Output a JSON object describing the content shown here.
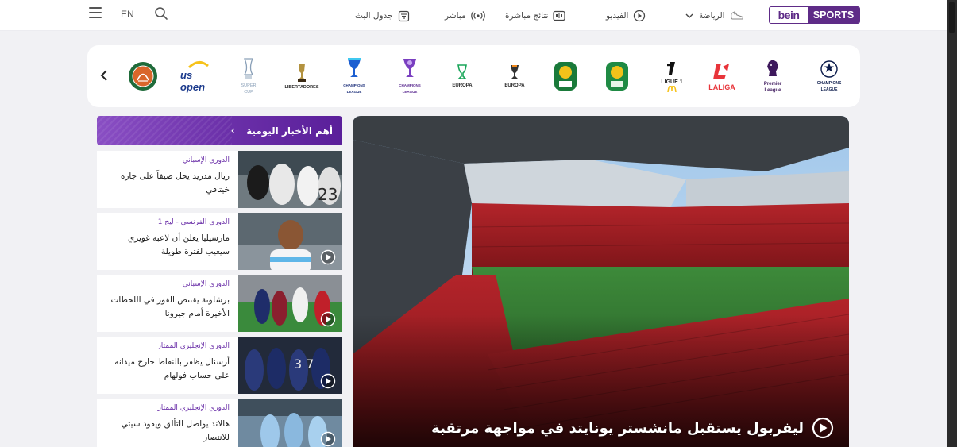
{
  "header": {
    "lang": "EN",
    "nav": [
      {
        "label": "جدول البث",
        "icon": "schedule-icon"
      },
      {
        "label": "مباشر",
        "icon": "live-broadcast-icon"
      },
      {
        "label": "نتائج مباشرة",
        "icon": "scoreboard-icon"
      },
      {
        "label": "الفيديو",
        "icon": "play-circle-icon"
      },
      {
        "label": "الرياضة",
        "icon": "sports-shoe-icon"
      }
    ],
    "logo_left": "bein",
    "logo_right": "SPORTS"
  },
  "competitions": [
    {
      "name": "Roland Garros",
      "label": ""
    },
    {
      "name": "US Open",
      "label": "us open"
    },
    {
      "name": "UEFA Super Cup",
      "label": "SUPER CUP"
    },
    {
      "name": "Copa Libertadores",
      "label": "LIBERTADORES"
    },
    {
      "name": "Champions League",
      "label": "CHAMPIONS LEAGUE"
    },
    {
      "name": "Women's Champions League",
      "label": "CHAMPIONS LEAGUE"
    },
    {
      "name": "Europa Conference League",
      "label": "EUROPA"
    },
    {
      "name": "Europa League",
      "label": "EUROPA"
    },
    {
      "name": "CAF",
      "label": "CAF"
    },
    {
      "name": "CAF Confederation",
      "label": "CAF"
    },
    {
      "name": "Ligue 1",
      "label": "LIGUE 1"
    },
    {
      "name": "LaLiga",
      "label": "LALIGA"
    },
    {
      "name": "Premier League",
      "label": "Premier League"
    },
    {
      "name": "UEFA Champions League",
      "label": "CHAMPIONS LEAGUE"
    }
  ],
  "news": {
    "header": "أهم الأخبار اليومية",
    "items": [
      {
        "category": "الدوري الإسباني",
        "title": "ريال مدريد يحل ضيفاً على جاره خيتافي",
        "video": false
      },
      {
        "category": "الدوري الفرنسي - ليج 1",
        "title": "مارسيليا يعلن أن لاعبه غويري سيغيب لفترة طويلة",
        "video": true
      },
      {
        "category": "الدوري الإسباني",
        "title": "برشلونة يقتنص الفوز في اللحظات الأخيرة أمام جيرونا",
        "video": true
      },
      {
        "category": "الدوري الإنجليزي الممتاز",
        "title": "أرسنال يظفر بالنقاط خارج ميدانه على حساب فولهام",
        "video": true
      },
      {
        "category": "الدوري الإنجليزي الممتاز",
        "title": "هالاند يواصل التألق ويقود سيتي للانتصار",
        "video": true
      }
    ]
  },
  "hero": {
    "title": "ليفربول يستقبل مانشستر يونايتد في مواجهة مرتقبة"
  },
  "colors": {
    "brand": "#5e2b87",
    "accent": "#6a2fa8"
  }
}
